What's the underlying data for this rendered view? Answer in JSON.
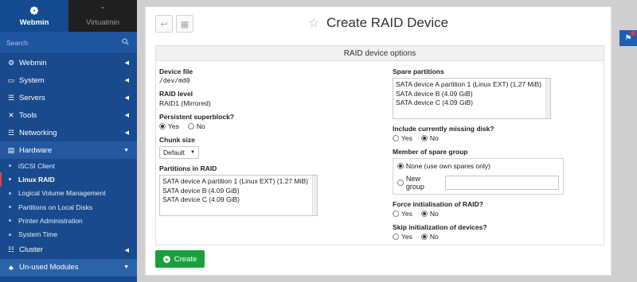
{
  "sidebar": {
    "brand_webmin": "Webmin",
    "brand_virtualmin": "Virtualmin",
    "search_placeholder": "Search",
    "items": [
      {
        "label": "Webmin",
        "icon": "gear-icon"
      },
      {
        "label": "System",
        "icon": "monitor-icon"
      },
      {
        "label": "Servers",
        "icon": "list-icon"
      },
      {
        "label": "Tools",
        "icon": "tools-icon"
      },
      {
        "label": "Networking",
        "icon": "network-icon"
      },
      {
        "label": "Hardware",
        "icon": "harddrive-icon",
        "expanded": true
      }
    ],
    "hardware_sub": [
      {
        "label": "iSCSI Client"
      },
      {
        "label": "Linux RAID",
        "selected": true
      },
      {
        "label": "Logical Volume Management"
      },
      {
        "label": "Partitions on Local Disks"
      },
      {
        "label": "Printer Administration"
      },
      {
        "label": "System Time"
      }
    ],
    "after_items": [
      {
        "label": "Cluster",
        "icon": "cluster-icon"
      },
      {
        "label": "Un-used Modules",
        "icon": "puzzle-icon"
      }
    ]
  },
  "header": {
    "title": "Create RAID Device"
  },
  "form": {
    "section_title": "RAID device options",
    "device_file_label": "Device file",
    "device_file_value": "/dev/md0",
    "raid_level_label": "RAID level",
    "raid_level_value": "RAID1 (Mirrored)",
    "superblock_label": "Persistent superblock?",
    "superblock_yes": "Yes",
    "superblock_no": "No",
    "chunk_label": "Chunk size",
    "chunk_value": "Default",
    "partitions_label": "Partitions in RAID",
    "partitions": [
      "SATA device A partition 1 (Linux EXT) (1.27 MiB)",
      "SATA device B (4.09 GiB)",
      "SATA device C (4.09 GiB)"
    ],
    "spare_label": "Spare partitions",
    "spares": [
      "SATA device A partition 1 (Linux EXT) (1.27 MiB)",
      "SATA device B (4.09 GiB)",
      "SATA device C (4.09 GiB)"
    ],
    "missing_label": "Include currently missing disk?",
    "missing_yes": "Yes",
    "missing_no": "No",
    "group_label": "Member of spare group",
    "group_none": "None (use own spares only)",
    "group_new": "New group",
    "force_label": "Force initialisation of RAID?",
    "force_yes": "Yes",
    "force_no": "No",
    "skip_label": "Skip initialization of devices?",
    "skip_yes": "Yes",
    "skip_no": "No"
  },
  "actions": {
    "create_label": "Create"
  }
}
